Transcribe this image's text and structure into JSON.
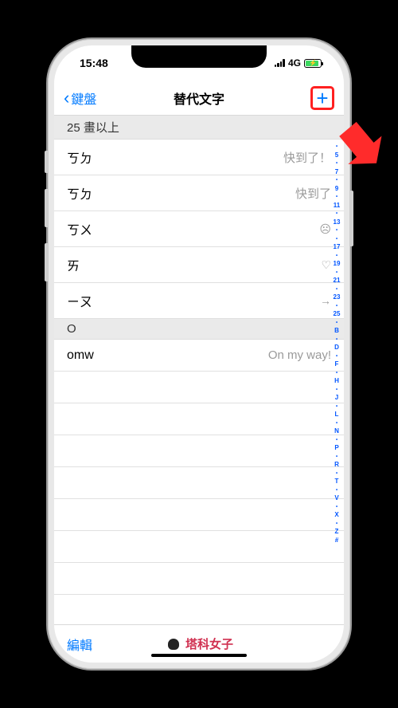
{
  "status": {
    "time": "15:48",
    "network": "4G"
  },
  "nav": {
    "back_label": "鍵盤",
    "title": "替代文字",
    "add_label": "+"
  },
  "sections": [
    {
      "header": "25 畫以上",
      "rows": [
        {
          "shortcut": "ㄎㄉ",
          "phrase": "快到了！",
          "icon": null
        },
        {
          "shortcut": "ㄎㄉ",
          "phrase": "快到了",
          "icon": null
        },
        {
          "shortcut": "ㄎㄨ",
          "phrase": "",
          "icon": "sad-face-icon"
        },
        {
          "shortcut": "ㄞ",
          "phrase": "",
          "icon": "heart-icon"
        },
        {
          "shortcut": "ㄧㄡ",
          "phrase": "",
          "icon": "arrow-right-icon"
        }
      ]
    },
    {
      "header": "O",
      "rows": [
        {
          "shortcut": "omw",
          "phrase": "On my way!",
          "icon": null
        }
      ]
    }
  ],
  "index": [
    "•",
    "5",
    "•",
    "7",
    "•",
    "9",
    "•",
    "11",
    "•",
    "13",
    "•",
    "•",
    "17",
    "•",
    "19",
    "•",
    "21",
    "•",
    "23",
    "•",
    "25",
    "•",
    "B",
    "•",
    "D",
    "•",
    "F",
    "•",
    "H",
    "•",
    "J",
    "•",
    "L",
    "•",
    "N",
    "•",
    "P",
    "•",
    "R",
    "•",
    "T",
    "•",
    "V",
    "•",
    "X",
    "•",
    "Z",
    "#"
  ],
  "toolbar": {
    "edit_label": "編輯",
    "brand_label": "塔科女子"
  },
  "icons": {
    "sad-face-icon": "☹",
    "heart-icon": "♡",
    "arrow-right-icon": "→"
  }
}
